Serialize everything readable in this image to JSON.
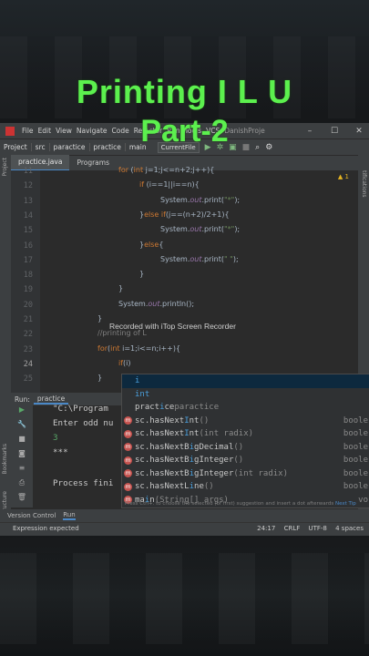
{
  "overlay": {
    "title": "Printing I L U",
    "subtitle": "Part-2"
  },
  "menu": {
    "items": [
      "File",
      "Edit",
      "View",
      "Navigate",
      "Code",
      "Refactor",
      "Run",
      "Tools",
      "VCS"
    ],
    "project_name": "DanishProje"
  },
  "nav": {
    "breadcrumbs": [
      "Project",
      "src",
      "paractice",
      "practice",
      "main"
    ],
    "run_config": "CurrentFile"
  },
  "tabs": [
    "practice.java",
    "Programs"
  ],
  "side_labels": {
    "left_top": "Project",
    "right": "Notifications",
    "left_bookmarks": "Bookmarks",
    "left_structure": "Structure"
  },
  "editor": {
    "warning_count": "1",
    "line_numbers": [
      "11",
      "12",
      "13",
      "14",
      "15",
      "16",
      "17",
      "18",
      "19",
      "20",
      "21",
      "22",
      "23",
      "24",
      "25"
    ],
    "lines": [
      [
        {
          "t": "for",
          "c": "kw"
        },
        {
          "t": " (",
          "c": ""
        },
        {
          "t": "int",
          "c": "kw"
        },
        {
          "t": " j=1;j<=n+2;j++){",
          "c": ""
        }
      ],
      [
        {
          "t": "if",
          "c": "kw"
        },
        {
          "t": " (i==1||i==n){",
          "c": ""
        }
      ],
      [
        {
          "t": "System.",
          "c": ""
        },
        {
          "t": "out",
          "c": "fld"
        },
        {
          "t": ".print(",
          "c": ""
        },
        {
          "t": "\"*\"",
          "c": "str"
        },
        {
          "t": ");",
          "c": ""
        }
      ],
      [
        {
          "t": "}",
          "c": ""
        },
        {
          "t": "else if",
          "c": "kw"
        },
        {
          "t": "(j==(n+2)/2+1){",
          "c": ""
        }
      ],
      [
        {
          "t": "System.",
          "c": ""
        },
        {
          "t": "out",
          "c": "fld"
        },
        {
          "t": ".print(",
          "c": ""
        },
        {
          "t": "\"*\"",
          "c": "str"
        },
        {
          "t": ");",
          "c": ""
        }
      ],
      [
        {
          "t": "}",
          "c": ""
        },
        {
          "t": "else",
          "c": "kw"
        },
        {
          "t": "{",
          "c": ""
        }
      ],
      [
        {
          "t": "System.",
          "c": ""
        },
        {
          "t": "out",
          "c": "fld"
        },
        {
          "t": ".print(",
          "c": ""
        },
        {
          "t": "\" \"",
          "c": "str"
        },
        {
          "t": ");",
          "c": ""
        }
      ],
      [
        {
          "t": "}",
          "c": ""
        }
      ],
      [
        {
          "t": "}",
          "c": ""
        }
      ],
      [
        {
          "t": "System.",
          "c": ""
        },
        {
          "t": "out",
          "c": "fld"
        },
        {
          "t": ".println();",
          "c": ""
        }
      ],
      [
        {
          "t": "}",
          "c": ""
        }
      ],
      [
        {
          "t": "//printing of L",
          "c": "cmt"
        }
      ],
      [
        {
          "t": "for",
          "c": "kw"
        },
        {
          "t": "(",
          "c": ""
        },
        {
          "t": "int",
          "c": "kw"
        },
        {
          "t": " i=1;i<=n;i++){",
          "c": ""
        }
      ],
      [
        {
          "t": "if",
          "c": "kw"
        },
        {
          "t": "(i)",
          "c": ""
        }
      ],
      [
        {
          "t": "}",
          "c": ""
        }
      ]
    ],
    "watermark": "Recorded with iTop Screen Recorder"
  },
  "completion": {
    "items": [
      {
        "pre": "",
        "match": "i",
        "rest": "",
        "tail": "",
        "type": ""
      },
      {
        "pre": "",
        "match": "int",
        "rest": "",
        "tail": "",
        "type": ""
      },
      {
        "pre": "pract",
        "match": "i",
        "rest": "ce",
        "tail": " paractice",
        "type": ""
      },
      {
        "pre": "sc.hasNext",
        "match": "I",
        "rest": "nt",
        "tail": "()",
        "type": "boole"
      },
      {
        "pre": "sc.hasNext",
        "match": "I",
        "rest": "nt",
        "tail": "(int radix)",
        "type": "boole"
      },
      {
        "pre": "sc.hasNextB",
        "match": "i",
        "rest": "gDecimal",
        "tail": "()",
        "type": "boole"
      },
      {
        "pre": "sc.hasNextB",
        "match": "i",
        "rest": "gInteger",
        "tail": "()",
        "type": "boole"
      },
      {
        "pre": "sc.hasNextB",
        "match": "i",
        "rest": "gInteger",
        "tail": "(int radix)",
        "type": "boole"
      },
      {
        "pre": "sc.hasNextL",
        "match": "i",
        "rest": "ne",
        "tail": "()",
        "type": "boole"
      },
      {
        "pre": "ma",
        "match": "i",
        "rest": "n",
        "tail": "(String[] args)",
        "type": "vo"
      }
    ],
    "hint_text": "Press Ctrl+. to choose the selected (or first) suggestion and insert a dot afterwards",
    "hint_link": "Next Tip"
  },
  "run_panel": {
    "label": "Run:",
    "tab": "practice",
    "output": [
      "\"C:\\Program",
      "Enter odd nu",
      "3",
      "***",
      "",
      "Process fini"
    ]
  },
  "bottom_bar": [
    "Version Control",
    "Run"
  ],
  "status": {
    "message": "Expression expected",
    "position": "24:17",
    "line_sep": "CRLF",
    "encoding": "UTF-8",
    "indent": "4 spaces"
  }
}
